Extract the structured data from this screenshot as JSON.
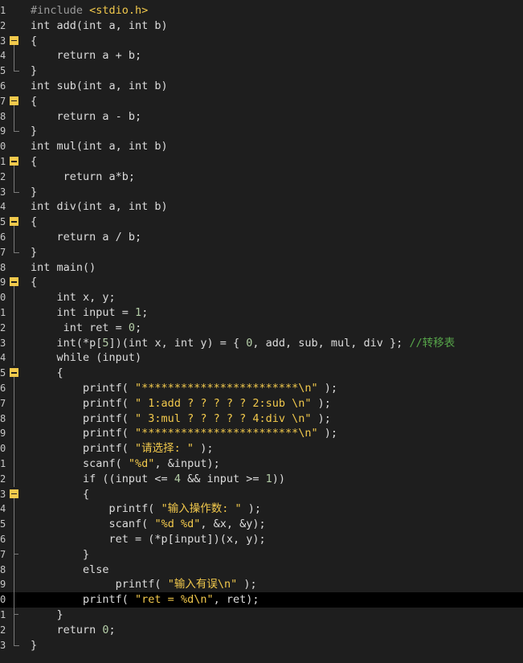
{
  "editor": {
    "lines": [
      {
        "n": "1",
        "code": "#include <stdio.h>"
      },
      {
        "n": "2",
        "code": "int add(int a, int b)"
      },
      {
        "n": "3",
        "code": "{"
      },
      {
        "n": "4",
        "code": "    return a + b;"
      },
      {
        "n": "5",
        "code": "}"
      },
      {
        "n": "6",
        "code": "int sub(int a, int b)"
      },
      {
        "n": "7",
        "code": "{"
      },
      {
        "n": "8",
        "code": "    return a - b;"
      },
      {
        "n": "9",
        "code": "}"
      },
      {
        "n": "0",
        "code": "int mul(int a, int b)"
      },
      {
        "n": "1",
        "code": "{"
      },
      {
        "n": "2",
        "code": "     return a*b;"
      },
      {
        "n": "3",
        "code": "}"
      },
      {
        "n": "4",
        "code": "int div(int a, int b)"
      },
      {
        "n": "5",
        "code": "{"
      },
      {
        "n": "6",
        "code": "    return a / b;"
      },
      {
        "n": "7",
        "code": "}"
      },
      {
        "n": "8",
        "code": "int main()"
      },
      {
        "n": "9",
        "code": "{"
      },
      {
        "n": "0",
        "code": "    int x, y;"
      },
      {
        "n": "1",
        "code": "    int input = 1;"
      },
      {
        "n": "2",
        "code": "     int ret = 0;"
      },
      {
        "n": "3",
        "code": "    int(*p[5])(int x, int y) = { 0, add, sub, mul, div }; //转移表"
      },
      {
        "n": "4",
        "code": "    while (input)"
      },
      {
        "n": "5",
        "code": "    {"
      },
      {
        "n": "6",
        "code": "        printf( \"************************\\n\" );"
      },
      {
        "n": "7",
        "code": "        printf( \" 1:add ? ? ? ? ? 2:sub \\n\" );"
      },
      {
        "n": "8",
        "code": "        printf( \" 3:mul ? ? ? ? ? 4:div \\n\" );"
      },
      {
        "n": "9",
        "code": "        printf( \"************************\\n\" );"
      },
      {
        "n": "0",
        "code": "        printf( \"请选择: \" );"
      },
      {
        "n": "1",
        "code": "        scanf( \"%d\", &input);"
      },
      {
        "n": "2",
        "code": "        if ((input <= 4 && input >= 1))"
      },
      {
        "n": "3",
        "code": "        {"
      },
      {
        "n": "4",
        "code": "            printf( \"输入操作数: \" );"
      },
      {
        "n": "5",
        "code": "            scanf( \"%d %d\", &x, &y);"
      },
      {
        "n": "6",
        "code": "            ret = (*p[input])(x, y);"
      },
      {
        "n": "7",
        "code": "        }"
      },
      {
        "n": "8",
        "code": "        else"
      },
      {
        "n": "9",
        "code": "             printf( \"输入有误\\n\" );"
      },
      {
        "n": "0",
        "code": "        printf( \"ret = %d\\n\", ret);"
      },
      {
        "n": "1",
        "code": "    }"
      },
      {
        "n": "2",
        "code": "    return 0;"
      },
      {
        "n": "3",
        "code": "}"
      }
    ],
    "current_line_index": 39,
    "colors": {
      "background": "#1e1e1e",
      "text": "#dcdcdc",
      "string": "#f2c94c",
      "number": "#b5cea8",
      "comment": "#57a64a",
      "fold_marker": "#f2c94c"
    }
  }
}
